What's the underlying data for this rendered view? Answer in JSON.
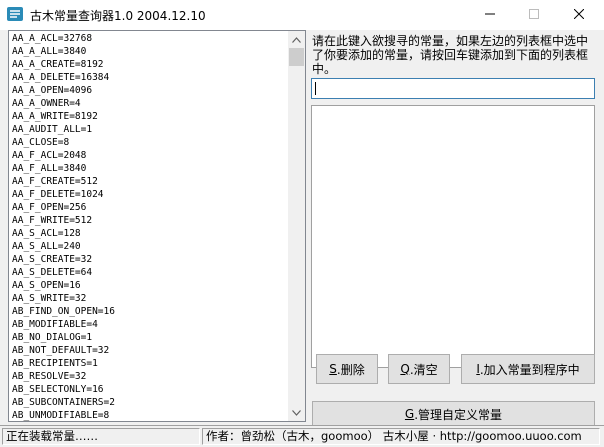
{
  "window": {
    "title": "古木常量查询器1.0  2004.12.10",
    "controls": {
      "minimize": "—",
      "maximize": "☐",
      "close": "✕"
    }
  },
  "constants_list": [
    "AA_A_ACL=32768",
    "AA_A_ALL=3840",
    "AA_A_CREATE=8192",
    "AA_A_DELETE=16384",
    "AA_A_OPEN=4096",
    "AA_A_OWNER=4",
    "AA_A_WRITE=8192",
    "AA_AUDIT_ALL=1",
    "AA_CLOSE=8",
    "AA_F_ACL=2048",
    "AA_F_ALL=3840",
    "AA_F_CREATE=512",
    "AA_F_DELETE=1024",
    "AA_F_OPEN=256",
    "AA_F_WRITE=512",
    "AA_S_ACL=128",
    "AA_S_ALL=240",
    "AA_S_CREATE=32",
    "AA_S_DELETE=64",
    "AA_S_OPEN=16",
    "AA_S_WRITE=32",
    "AB_FIND_ON_OPEN=16",
    "AB_MODIFIABLE=4",
    "AB_NO_DIALOG=1",
    "AB_NOT_DEFAULT=32",
    "AB_RECIPIENTS=1",
    "AB_RESOLVE=32",
    "AB_SELECTONLY=16",
    "AB_SUBCONTAINERS=2",
    "AB_UNMODIFIABLE=8"
  ],
  "scrollbar": {
    "up": "▲",
    "down": "▼"
  },
  "instruction": "请在此键入欲搜寻的常量，如果左边的列表框中选中了你要添加的常量，请按回车键添加到下面的列表框中。",
  "search": {
    "value": ""
  },
  "buttons": {
    "delete": {
      "key": "S",
      "label": ".删除"
    },
    "clear": {
      "key": "Q",
      "label": ".清空"
    },
    "add": {
      "key": "I",
      "label": ".加入常量到程序中"
    },
    "manage": {
      "key": "G",
      "label": ".管理自定义常量"
    }
  },
  "status": {
    "left": "正在装载常量……",
    "right": "作者：曾劲松（古木，goomoo） 古木小屋 · http://goomoo.uuoo.com"
  },
  "colors": {
    "input_focus_border": "#3c7fb1",
    "button_face": "#e1e1e1",
    "dialog_face": "#f0f0f0"
  }
}
